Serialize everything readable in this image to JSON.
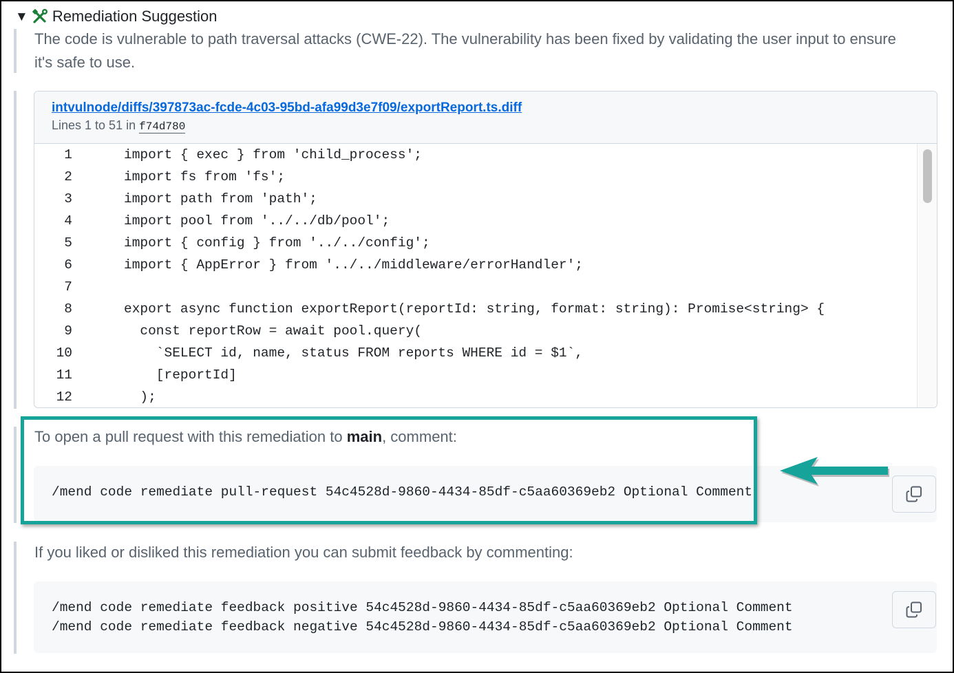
{
  "summary": {
    "title": "Remediation Suggestion",
    "triangle": "▼",
    "icon": "tools-icon"
  },
  "description": "The code is vulnerable to path traversal attacks (CWE-22). The vulnerability has been fixed by validating the user input to ensure it's safe to use.",
  "snippet": {
    "link": "intvulnode/diffs/397873ac-fcde-4c03-95bd-afa99d3e7f09/exportReport.ts.diff",
    "lines_label": "Lines 1 to 51 in",
    "commit": "f74d780",
    "lines": [
      {
        "n": "1",
        "code": "import { exec } from 'child_process';"
      },
      {
        "n": "2",
        "code": "import fs from 'fs';"
      },
      {
        "n": "3",
        "code": "import path from 'path';"
      },
      {
        "n": "4",
        "code": "import pool from '../../db/pool';"
      },
      {
        "n": "5",
        "code": "import { config } from '../../config';"
      },
      {
        "n": "6",
        "code": "import { AppError } from '../../middleware/errorHandler';"
      },
      {
        "n": "7",
        "code": ""
      },
      {
        "n": "8",
        "code": "export async function exportReport(reportId: string, format: string): Promise<string> {"
      },
      {
        "n": "9",
        "code": "  const reportRow = await pool.query("
      },
      {
        "n": "10",
        "code": "    `SELECT id, name, status FROM reports WHERE id = $1`,"
      },
      {
        "n": "11",
        "code": "    [reportId]"
      },
      {
        "n": "12",
        "code": "  );"
      }
    ]
  },
  "pull_request": {
    "text_before": "To open a pull request with this remediation to ",
    "branch": "main",
    "text_after": ", comment:",
    "command": "/mend code remediate pull-request 54c4528d-9860-4434-85df-c5aa60369eb2 Optional Comment"
  },
  "feedback": {
    "text": "If you liked or disliked this remediation you can submit feedback by commenting:",
    "command_positive": "/mend code remediate feedback positive 54c4528d-9860-4434-85df-c5aa60369eb2 Optional Comment",
    "command_negative": "/mend code remediate feedback negative 54c4528d-9860-4434-85df-c5aa60369eb2 Optional Comment"
  },
  "colors": {
    "link": "#0969da",
    "highlight": "#15a39a",
    "icon_green": "#1a7f37"
  }
}
